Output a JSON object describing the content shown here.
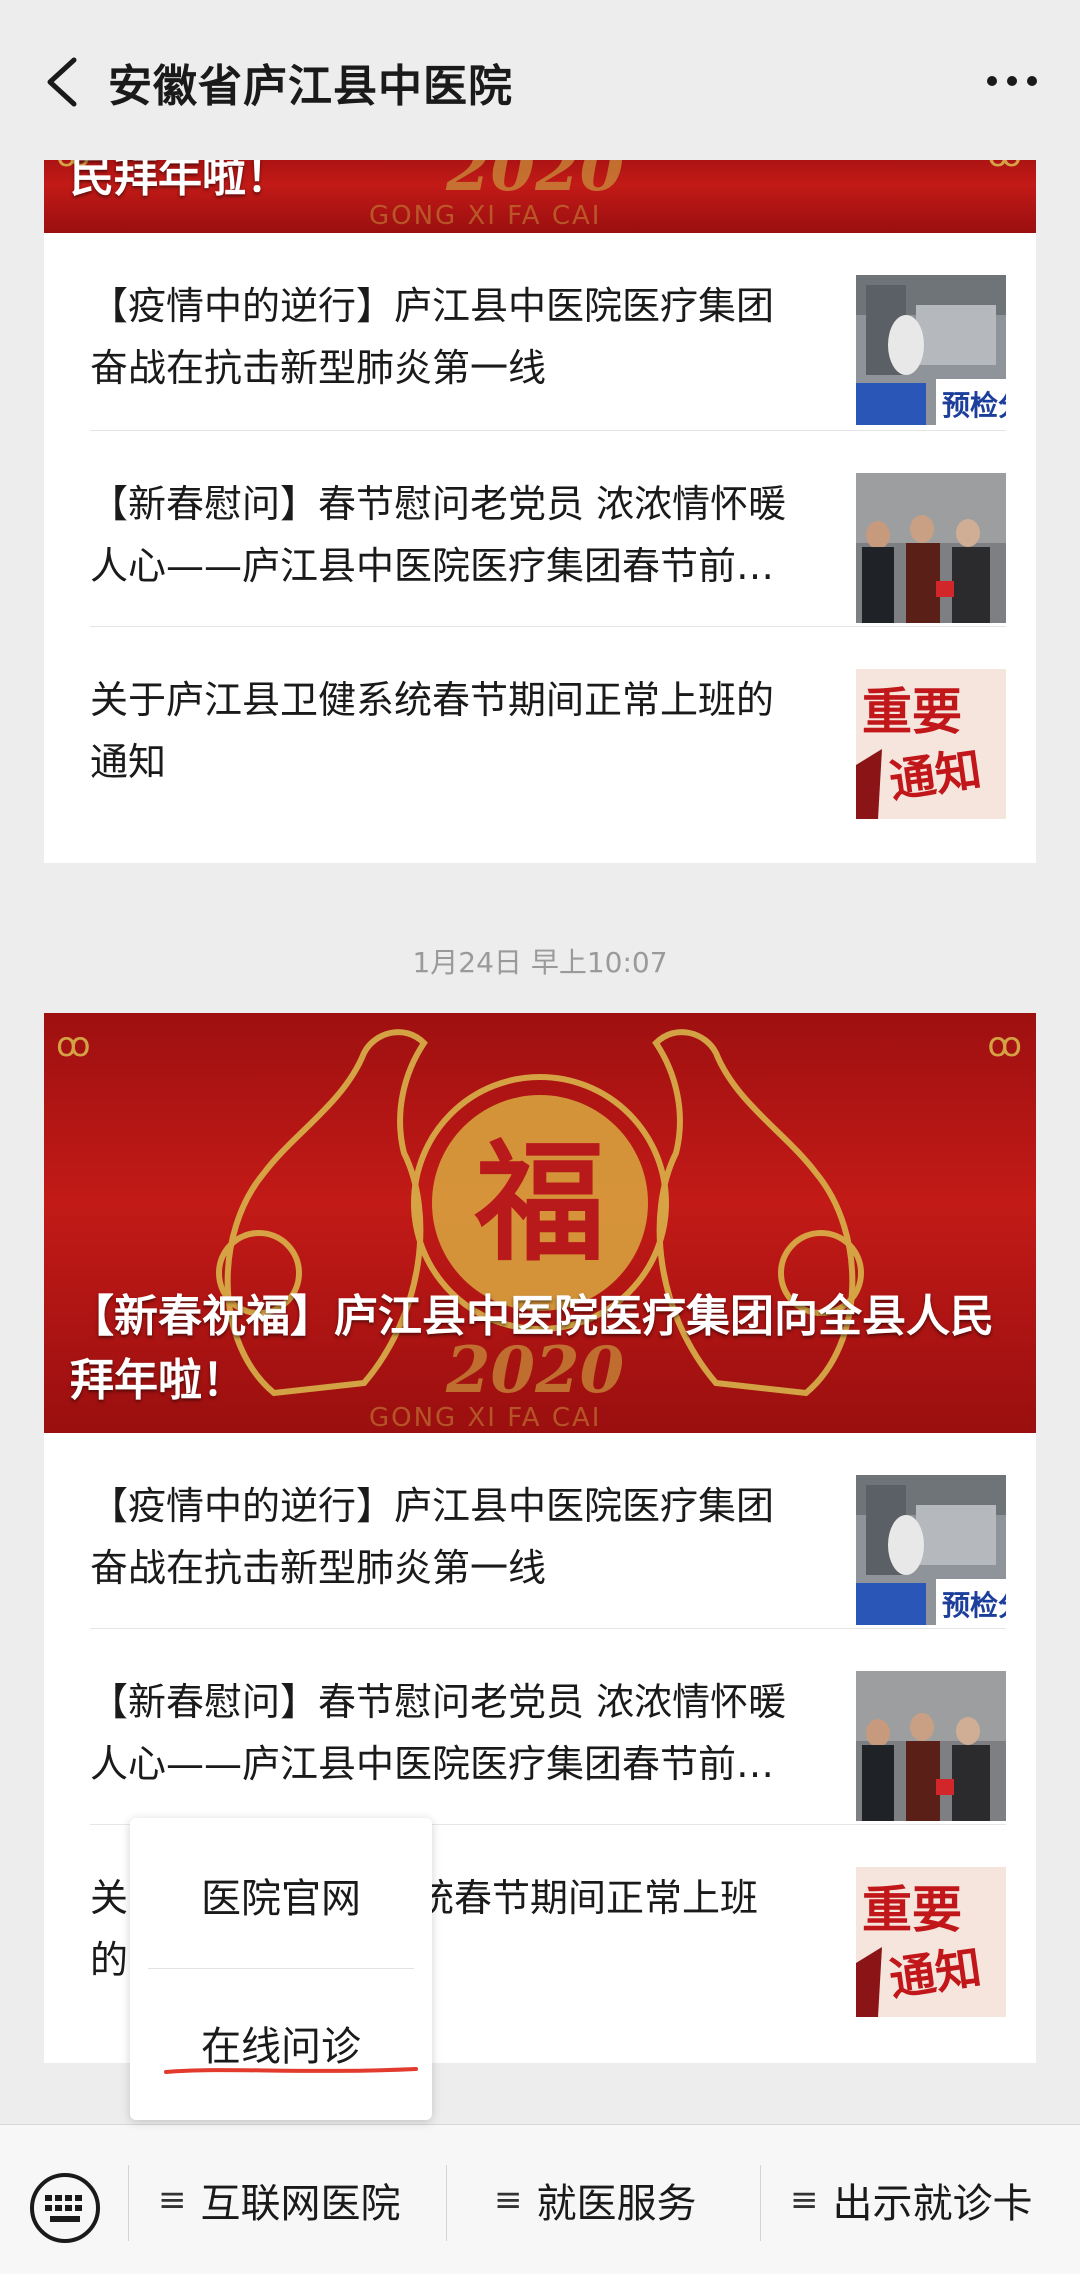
{
  "header": {
    "title": "安徽省庐江县中医院"
  },
  "feed": {
    "cards": [
      {
        "cover_title": "民拜年啦！",
        "cover_year": "2020",
        "cover_motto": "GONG XI FA CAI",
        "articles": [
          {
            "title": "【疫情中的逆行】庐江县中医院医疗集团奋战在抗击新型肺炎第一线",
            "thumb_label": "预检分"
          },
          {
            "title": "【新春慰问】春节慰问老党员 浓浓情怀暖人心——庐江县中医院医疗集团春节前…"
          },
          {
            "title": "关于庐江县卫健系统春节期间正常上班的通知",
            "thumb_label_1": "重要",
            "thumb_label_2": "通知"
          }
        ]
      },
      {
        "timestamp": "1月24日 早上10:07",
        "cover_title": "【新春祝福】庐江县中医院医疗集团向全县人民拜年啦！",
        "cover_year": "2020",
        "cover_motto": "GONG XI FA CAI",
        "cover_glyph": "福",
        "articles": [
          {
            "title": "【疫情中的逆行】庐江县中医院医疗集团奋战在抗击新型肺炎第一线",
            "thumb_label": "预检分"
          },
          {
            "title": "【新春慰问】春节慰问老党员 浓浓情怀暖人心——庐江县中医院医疗集团春节前…"
          },
          {
            "title": "关于庐江县卫健系统春节期间正常上班的通知",
            "visible_title_start": "关",
            "visible_title_mid": "统春节期间正常上班",
            "visible_title_line2": "的",
            "thumb_label_1": "重要",
            "thumb_label_2": "通知"
          }
        ]
      }
    ]
  },
  "popup_menu": {
    "items": [
      "医院官网",
      "在线问诊"
    ]
  },
  "bottom_menu": {
    "items": [
      "互联网医院",
      "就医服务",
      "出示就诊卡"
    ],
    "lines_glyph": "≡"
  },
  "colors": {
    "cover_red": "#c21a17",
    "underline_red": "#e23b2e",
    "gold": "#d9b24a"
  }
}
